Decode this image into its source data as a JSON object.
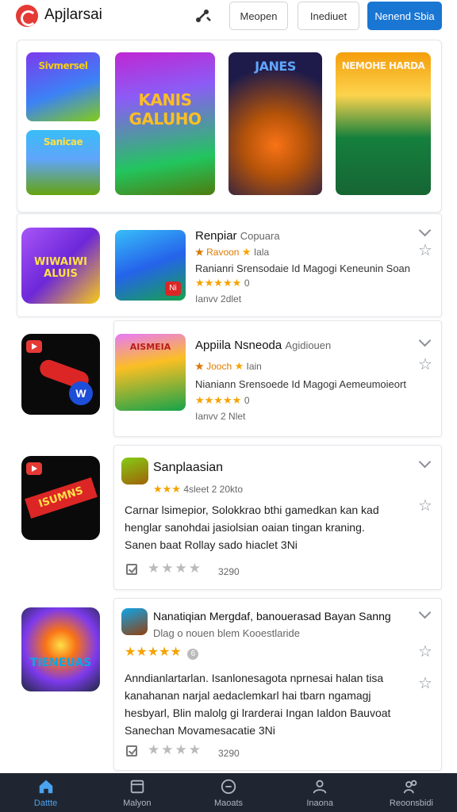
{
  "header": {
    "app_title": "Apjlarsai",
    "buttons": {
      "b1": "Meopen",
      "b2": "Inediuet",
      "primary": "Nenend Sbia"
    },
    "accent": "#1976d2"
  },
  "featured": {
    "tiles": [
      {
        "text": "Sivmersel"
      },
      {
        "text": "Sanicae"
      },
      {
        "text": "KANIS GALUHO"
      },
      {
        "text": "JANES"
      },
      {
        "text": "NEMOHE HARDA"
      }
    ]
  },
  "apps": [
    {
      "side_thumb_text": "WIWAIWI ALUIS",
      "icon_badge": "Ni",
      "title": "Renpiar",
      "subtitle": "Copuara",
      "rating_label": "Ravoon",
      "rating_extra": "Iala",
      "description": "Ranianri Srensodaie Id Magogi Keneunin Soan",
      "review_count": "0",
      "meta": "Ianvv 2dlet"
    },
    {
      "side_thumb_text": "W",
      "icon_text": "AISMEIA",
      "title": "Appiila Nsneoda",
      "subtitle": "Agidiouen",
      "rating_label": "Jooch",
      "rating_extra": "Iain",
      "description": "Nianiann Srensoede Id Magogi Aemeumoieort",
      "review_count": "0",
      "meta": "Ianvv 2 Nlet"
    },
    {
      "side_thumb_text": "ISUMNS",
      "title": "Sanplaasian",
      "rating_meta": "4sleet 2 20kto",
      "body_lines": [
        "Carnar lsimepior, Solokkrao bthi gamedkan kan kad",
        "henglar sanohdai jasiolsian oaian tingan kraning.",
        "Sanen baat Rollay sado hiaclet 3Ni"
      ],
      "footer_count": "3290"
    },
    {
      "side_thumb_text": "TIENEUAS",
      "title": "Nanatiqian Mergdaf, banouerasad Bayan Sanng",
      "subtitle": "Dlag o nouen blem Kooestlaride",
      "rating_badge": "6",
      "body_lines": [
        "Anndianlartarlan. Isanlonesagota nprnesai halan tisa",
        "kanahanan narjal aedaclemkarl hai tbarn ngamagj",
        "hesbyarl, Blin malolg gi lrarderai Ingan Ialdon Bauvoat",
        "Sanechan Movamesacatie 3Ni"
      ],
      "footer_count": "3290"
    }
  ],
  "nav": [
    {
      "label": "Dattte",
      "icon": "home-icon",
      "active": true
    },
    {
      "label": "Malyon",
      "icon": "library-icon",
      "active": false
    },
    {
      "label": "Maoats",
      "icon": "clock-icon",
      "active": false
    },
    {
      "label": "Inaona",
      "icon": "profile-icon",
      "active": false
    },
    {
      "label": "Reoonsbidi",
      "icon": "people-icon",
      "active": false
    }
  ]
}
